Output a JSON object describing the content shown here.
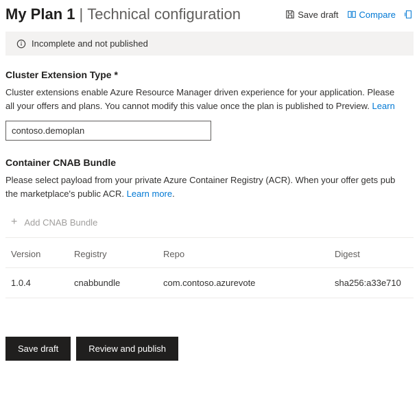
{
  "header": {
    "plan_name": "My Plan 1",
    "page_title": "Technical configuration",
    "actions": {
      "save_draft": "Save draft",
      "compare": "Compare"
    }
  },
  "status": {
    "message": "Incomplete and not published"
  },
  "cluster": {
    "heading": "Cluster Extension Type",
    "required": "*",
    "desc_a": "Cluster extensions enable Azure Resource Manager driven experience for your application. Please",
    "desc_b": "all your offers and plans. You cannot modify this value once the plan is published to Preview. ",
    "learn": "Learn",
    "value": "contoso.demoplan"
  },
  "cnab": {
    "heading": "Container CNAB Bundle",
    "desc_a": "Please select payload from your private Azure Container Registry (ACR). When your offer gets pub",
    "desc_b": "the marketplace's public ACR. ",
    "learn": "Learn more",
    "add_label": "Add CNAB Bundle",
    "columns": {
      "version": "Version",
      "registry": "Registry",
      "repo": "Repo",
      "digest": "Digest"
    },
    "rows": [
      {
        "version": "1.0.4",
        "registry": "cnabbundle",
        "repo": "com.contoso.azurevote",
        "digest": "sha256:a33e710"
      }
    ]
  },
  "footer": {
    "save_draft": "Save draft",
    "review_publish": "Review and publish"
  }
}
